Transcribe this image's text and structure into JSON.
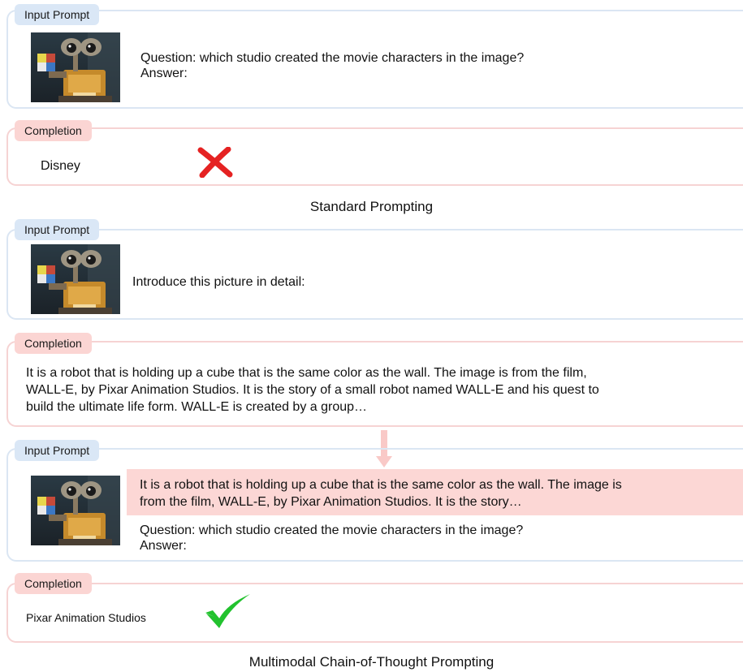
{
  "colors": {
    "prompt_tag": "#dae7f6",
    "completion_tag": "#fbd5d3",
    "highlight": "#fcd7d5",
    "cross": "#e52222",
    "check": "#22c22e"
  },
  "standard": {
    "input_tag": "Input Prompt",
    "question": "Question: which studio created the movie characters in the image?",
    "answer_label": "Answer:",
    "completion_tag": "Completion",
    "completion_text": "Disney",
    "result_icon": "cross-icon",
    "caption": "Standard Prompting"
  },
  "multimodal": {
    "step1": {
      "input_tag": "Input Prompt",
      "instruction": "Introduce this picture in detail:",
      "completion_tag": "Completion",
      "completion_lines": [
        "It is a robot that is holding up a cube that is the same color as the wall. The image is from the film,",
        "WALL-E, by Pixar Animation Studios. It is the story of a small robot named WALL-E and his quest to",
        "build the ultimate life form. WALL-E is created by a group…"
      ]
    },
    "step2": {
      "input_tag": "Input Prompt",
      "rationale_lines": [
        "It is a robot that is holding up a cube that is the same color as the wall. The image is",
        "from the film, WALL-E, by Pixar Animation Studios. It is the story…"
      ],
      "question": "Question: which studio created the movie characters in the image?",
      "answer_label": "Answer:",
      "completion_tag": "Completion",
      "completion_text": "Pixar Animation Studios",
      "result_icon": "check-icon"
    },
    "caption": "Multimodal Chain-of-Thought Prompting"
  }
}
